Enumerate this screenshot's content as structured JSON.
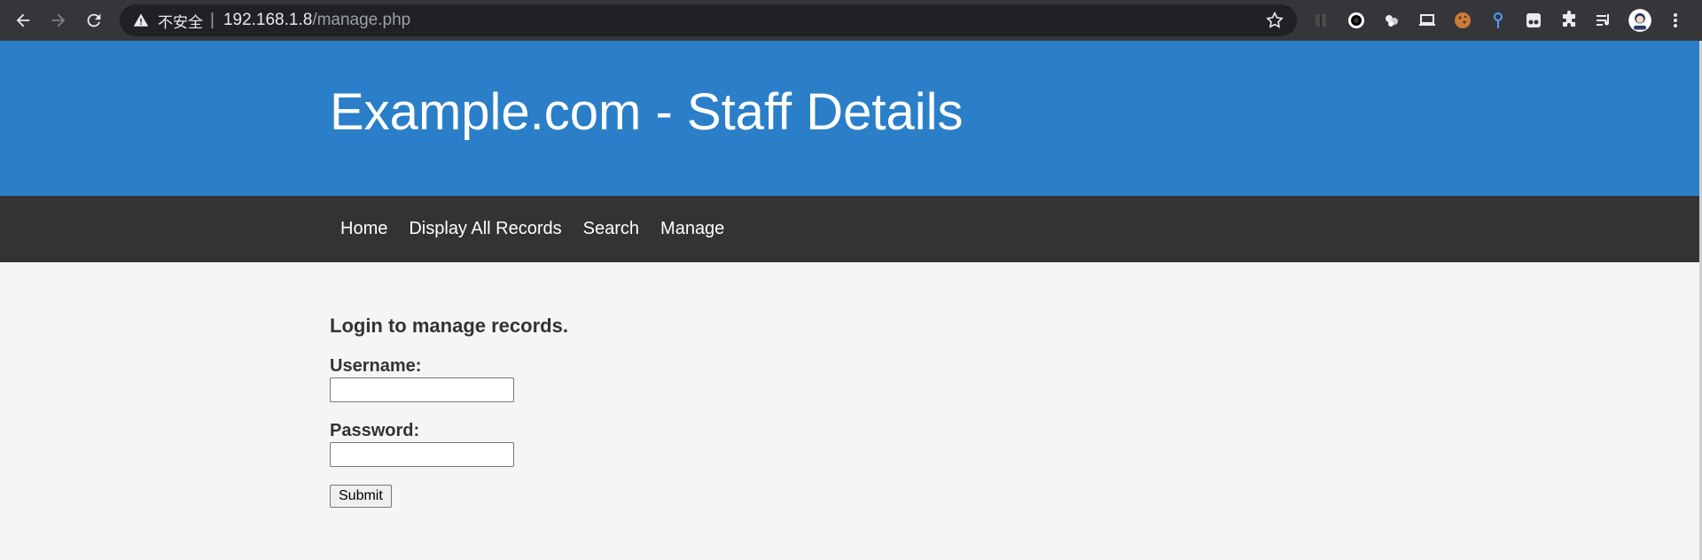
{
  "browser": {
    "security_label": "不安全",
    "separator": "|",
    "url_host": "192.168.1.8",
    "url_path": "/manage.php"
  },
  "site": {
    "title": "Example.com - Staff Details",
    "header_color": "#2b7fc8",
    "navbar_color": "#333333"
  },
  "nav": {
    "items": [
      {
        "label": "Home"
      },
      {
        "label": "Display All Records"
      },
      {
        "label": "Search"
      },
      {
        "label": "Manage"
      }
    ]
  },
  "login": {
    "heading": "Login to manage records.",
    "username_label": "Username:",
    "username_value": "",
    "password_label": "Password:",
    "password_value": "",
    "submit_label": "Submit"
  }
}
